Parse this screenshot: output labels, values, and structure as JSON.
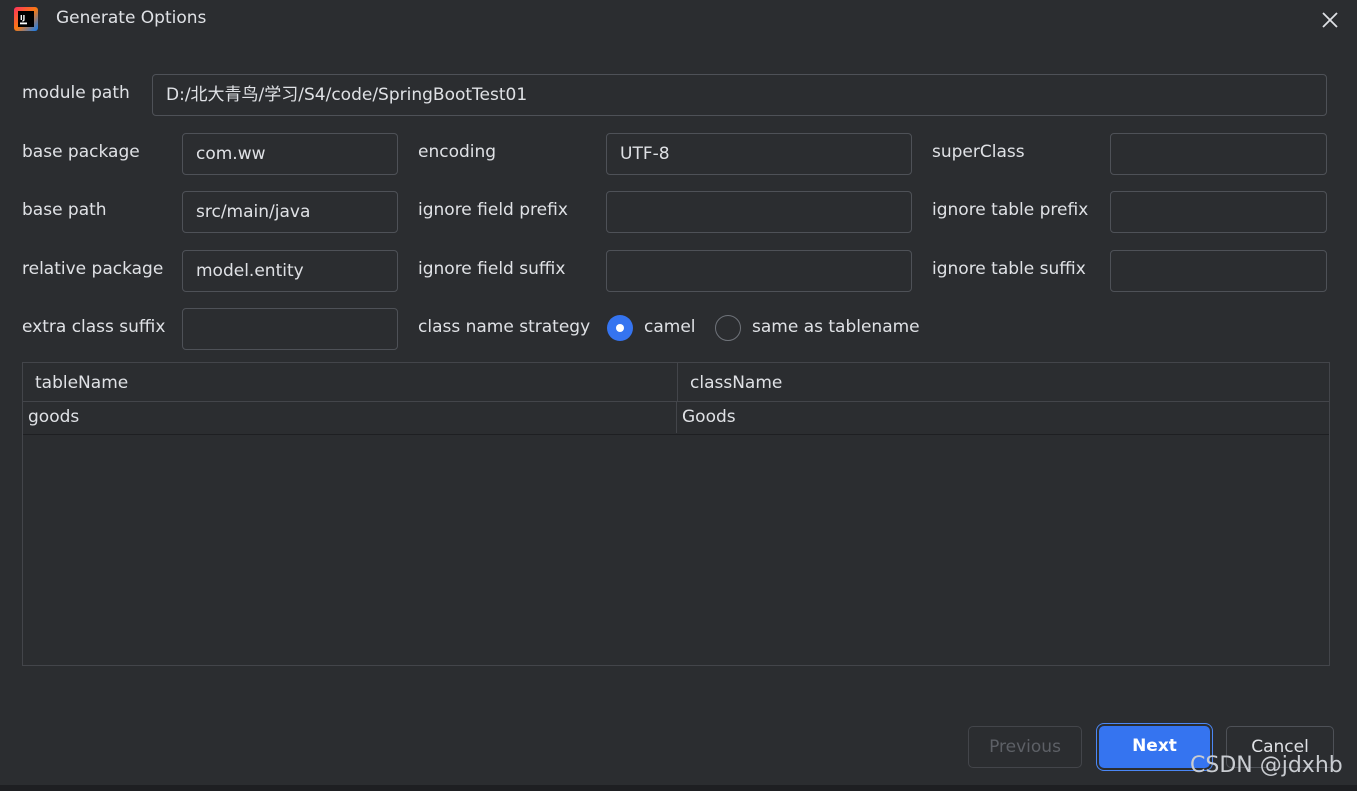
{
  "window": {
    "title": "Generate Options",
    "app_icon": "intellij-idea-icon",
    "close_icon": "close-icon"
  },
  "form": {
    "module_path": {
      "label": "module path",
      "value": "D:/北大青鸟/学习/S4/code/SpringBootTest01"
    },
    "base_package": {
      "label": "base package",
      "value": "com.ww"
    },
    "encoding": {
      "label": "encoding",
      "value": "UTF-8"
    },
    "super_class": {
      "label": "superClass",
      "value": ""
    },
    "base_path": {
      "label": "base path",
      "value": "src/main/java"
    },
    "ignore_field_prefix": {
      "label": "ignore field prefix",
      "value": ""
    },
    "ignore_table_prefix": {
      "label": "ignore table prefix",
      "value": ""
    },
    "relative_package": {
      "label": "relative package",
      "value": "model.entity"
    },
    "ignore_field_suffix": {
      "label": "ignore field suffix",
      "value": ""
    },
    "ignore_table_suffix": {
      "label": "ignore table suffix",
      "value": ""
    },
    "extra_class_suffix": {
      "label": "extra class suffix",
      "value": ""
    },
    "class_name_strategy": {
      "label": "class name strategy",
      "options": [
        "camel",
        "same as tablename"
      ],
      "selected": "camel"
    }
  },
  "table": {
    "columns": [
      "tableName",
      "className"
    ],
    "rows": [
      [
        "goods",
        "Goods"
      ]
    ]
  },
  "buttons": {
    "previous": "Previous",
    "next": "Next",
    "cancel": "Cancel"
  },
  "watermark": "CSDN @jdxhb",
  "colors": {
    "background": "#2b2d30",
    "accent": "#3574f0",
    "border": "#4e5157",
    "text": "#dfe1e5"
  }
}
